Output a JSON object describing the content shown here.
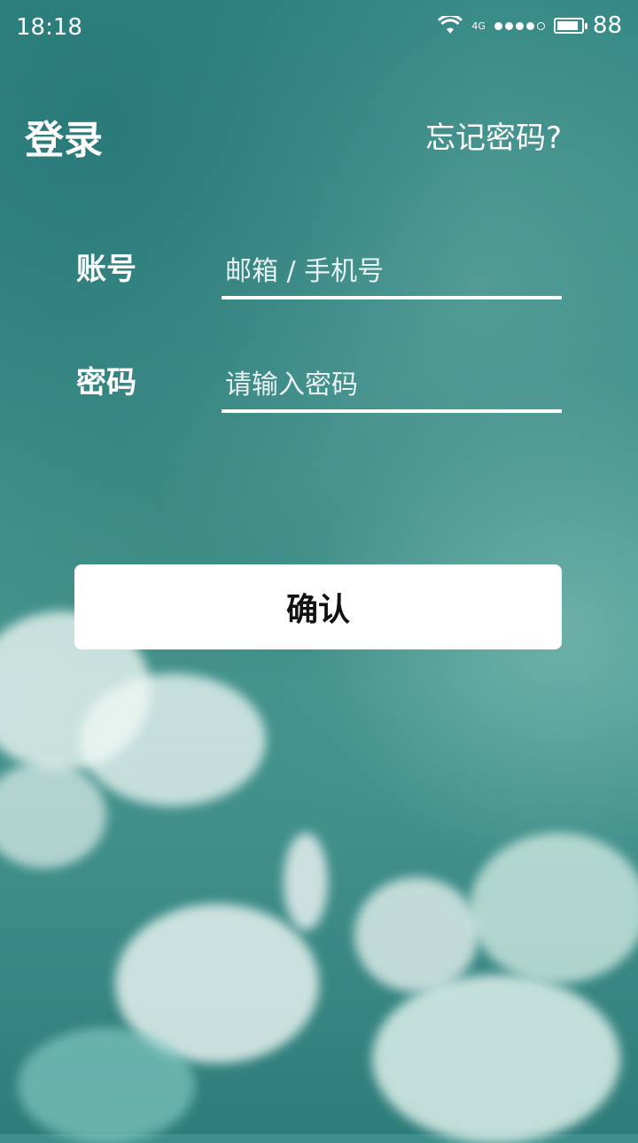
{
  "status_bar": {
    "time": "18:18",
    "network": "4G",
    "battery": "88"
  },
  "header": {
    "title": "登录",
    "forgot_link": "忘记密码?"
  },
  "form": {
    "account_label": "账号",
    "account_placeholder": "邮箱 / 手机号",
    "password_label": "密码",
    "password_placeholder": "请输入密码"
  },
  "actions": {
    "confirm_label": "确认"
  },
  "icons": {
    "wifi": "wifi-icon",
    "signal": "signal-strength-icon",
    "battery": "battery-icon"
  },
  "colors": {
    "background": "#3f8f8d",
    "text": "#ffffff",
    "button_bg": "#ffffff",
    "button_text": "#111111"
  }
}
